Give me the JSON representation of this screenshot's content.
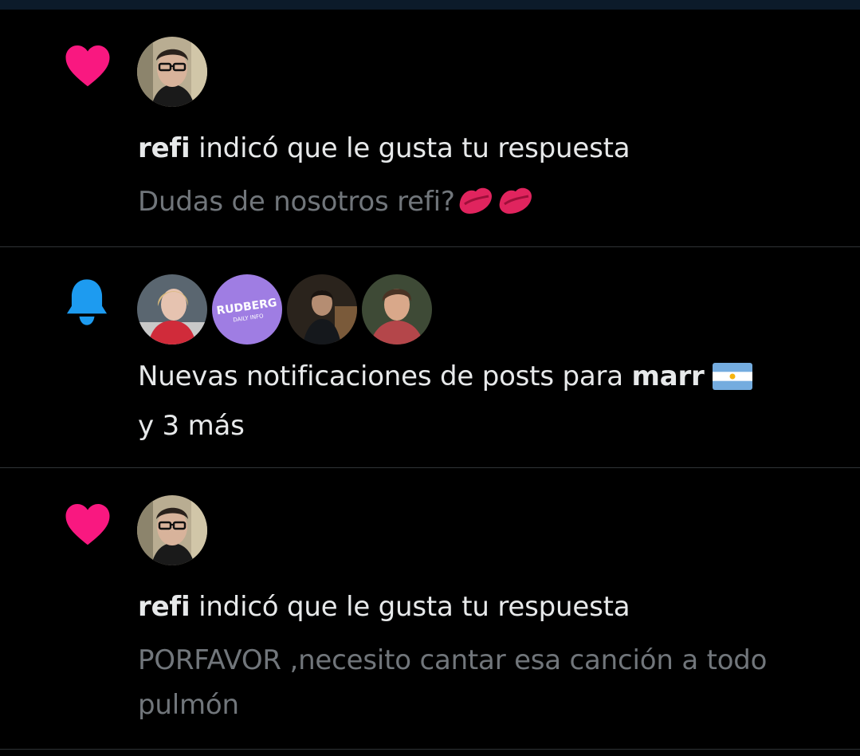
{
  "notifications": [
    {
      "type": "like",
      "icon": "heart-icon",
      "user": "refi",
      "action": " indicó que le gusta tu respuesta",
      "snippet": "Dudas de nosotros refi?"
    },
    {
      "type": "post-notifications",
      "icon": "bell-icon",
      "text_before": "Nuevas notificaciones de posts para ",
      "user": "marr",
      "text_after": "y 3 más",
      "avatar_badge_text": "RUDBERG",
      "avatar_badge_sub": "DAILY INFO"
    },
    {
      "type": "like",
      "icon": "heart-icon",
      "user": "refi",
      "action": " indicó que le gusta tu respuesta",
      "snippet": "PORFAVOR ,necesito cantar esa canción a todo pulmón"
    }
  ],
  "colors": {
    "background": "#000000",
    "heart": "#f91880",
    "bell": "#1d9bf0",
    "primary_text": "#e7e9ea",
    "secondary_text": "#71767b",
    "divider": "#2f3336",
    "badge_purple": "#9f7de3"
  }
}
